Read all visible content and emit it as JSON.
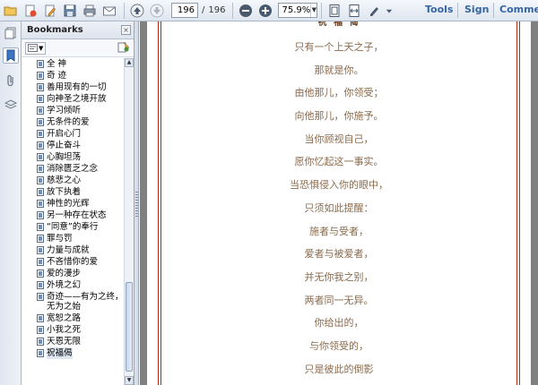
{
  "toolbar": {
    "current_page": "196",
    "page_separator": "/",
    "total_pages": "196",
    "zoom": "75.9%",
    "menu": [
      "Tools",
      "Sign",
      "Comment"
    ]
  },
  "panel": {
    "title": "Bookmarks",
    "close": "×"
  },
  "bookmarks": [
    {
      "label": "全  神",
      "multi": false
    },
    {
      "label": "奇  迹",
      "multi": false
    },
    {
      "label": "善用现有的一切",
      "multi": false
    },
    {
      "label": "向神圣之境开放",
      "multi": false
    },
    {
      "label": "学习倾听",
      "multi": false
    },
    {
      "label": "无条件的爱",
      "multi": false
    },
    {
      "label": "开启心门",
      "multi": false
    },
    {
      "label": "停止奋斗",
      "multi": false
    },
    {
      "label": "心胸坦荡",
      "multi": false
    },
    {
      "label": "消除匮乏之念",
      "multi": false
    },
    {
      "label": "慈悲之心",
      "multi": false
    },
    {
      "label": "放下执着",
      "multi": false
    },
    {
      "label": "神性的光辉",
      "multi": false
    },
    {
      "label": "另一种存在状态",
      "multi": false
    },
    {
      "label": "“同意”的奉行",
      "multi": false
    },
    {
      "label": "罪与罚",
      "multi": false
    },
    {
      "label": "力量与成就",
      "multi": false
    },
    {
      "label": "不吝惜你的爱",
      "multi": false
    },
    {
      "label": "爱的漫步",
      "multi": false
    },
    {
      "label": "外境之幻",
      "multi": false
    },
    {
      "label": "奇迹——有为之终，无为之始",
      "multi": true
    },
    {
      "label": "宽恕之路",
      "multi": false
    },
    {
      "label": "小我之死",
      "multi": false
    },
    {
      "label": "天恩无限",
      "multi": false
    },
    {
      "label": "祝福偈",
      "multi": false,
      "selected": true
    }
  ],
  "document": {
    "title": "祝 福 偈",
    "lines": [
      "只有一个上天之子，",
      "那就是你。",
      "由他那儿，你领受；",
      "向他那儿，你施予。",
      "当你顾视自己，",
      "愿你忆起这一事实。",
      "当恐惧侵入你的眼中，",
      "只须如此提醒：",
      "施者与受者，",
      "爱者与被爱者，",
      "并无你我之别，",
      "两者同一无异。",
      "你给出的，",
      "与你领受的，",
      "只是彼此的倒影"
    ]
  },
  "colors": {
    "page_border": "#b52d13",
    "text": "#8a6a4c",
    "menu_text": "#3465a4"
  }
}
